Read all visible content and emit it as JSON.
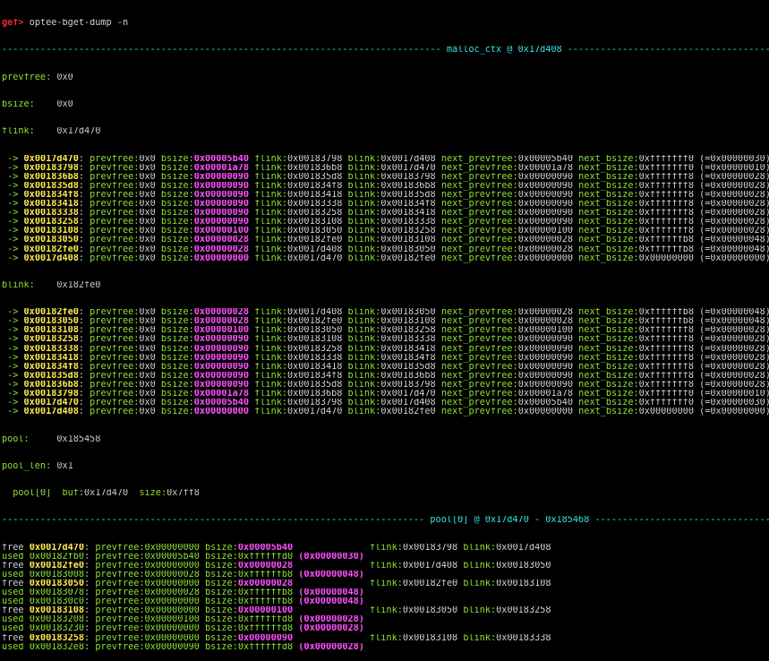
{
  "prompt": "gef>",
  "command": "optee-bget-dump -n",
  "header1": {
    "left": "--------------------------------------------------------------------------------",
    "title": "malloc_ctx @ 0x17d408",
    "right": "--------------------------------------------------------------------"
  },
  "ctx": {
    "prevfree_label": "prevfree:",
    "prevfree": "0x0",
    "bsize_label": "bsize:",
    "bsize": "0x0",
    "flink_label": "flink:",
    "flink": "0x17d470",
    "blink_label": "blink:",
    "blink": "0x182fe0",
    "pool_label": "pool:",
    "pool": "0x185458",
    "pool_len_label": "pool_len:",
    "pool_len": "0x1",
    "pool0": "pool[0]",
    "buf_label": "buf:",
    "buf": "0x17d470",
    "size_label": "size:",
    "size": "0x7ff8"
  },
  "flink_rows": [
    {
      "addr": "0x0017d470",
      "prevfree": "0x0",
      "bsize": "0x00005b40",
      "flink": "0x00183798",
      "blink": "0x0017d408",
      "np": "0x00005b40",
      "nb": "0xfffffff0",
      "eq": "(=0x00000030)"
    },
    {
      "addr": "0x00183798",
      "prevfree": "0x0",
      "bsize": "0x00001a78",
      "flink": "0x001836b8",
      "blink": "0x0017d470",
      "np": "0x00001a78",
      "nb": "0xfffffff0",
      "eq": "(=0x00000010)"
    },
    {
      "addr": "0x001836b8",
      "prevfree": "0x0",
      "bsize": "0x00000090",
      "flink": "0x001835d8",
      "blink": "0x00183798",
      "np": "0x00000090",
      "nb": "0xfffffff8",
      "eq": "(=0x00000028)"
    },
    {
      "addr": "0x001835d8",
      "prevfree": "0x0",
      "bsize": "0x00000090",
      "flink": "0x001834f8",
      "blink": "0x001836b8",
      "np": "0x00000090",
      "nb": "0xfffffff8",
      "eq": "(=0x00000028)"
    },
    {
      "addr": "0x001834f8",
      "prevfree": "0x0",
      "bsize": "0x00000090",
      "flink": "0x00183418",
      "blink": "0x001835d8",
      "np": "0x00000090",
      "nb": "0xfffffff8",
      "eq": "(=0x00000028)"
    },
    {
      "addr": "0x00183418",
      "prevfree": "0x0",
      "bsize": "0x00000090",
      "flink": "0x00183338",
      "blink": "0x001834f8",
      "np": "0x00000090",
      "nb": "0xfffffff8",
      "eq": "(=0x00000028)"
    },
    {
      "addr": "0x00183338",
      "prevfree": "0x0",
      "bsize": "0x00000090",
      "flink": "0x00183258",
      "blink": "0x00183418",
      "np": "0x00000090",
      "nb": "0xfffffff8",
      "eq": "(=0x00000028)"
    },
    {
      "addr": "0x00183258",
      "prevfree": "0x0",
      "bsize": "0x00000090",
      "flink": "0x00183108",
      "blink": "0x00183338",
      "np": "0x00000090",
      "nb": "0xfffffff8",
      "eq": "(=0x00000028)"
    },
    {
      "addr": "0x00183108",
      "prevfree": "0x0",
      "bsize": "0x00000100",
      "flink": "0x00183050",
      "blink": "0x00183258",
      "np": "0x00000100",
      "nb": "0xfffffff8",
      "eq": "(=0x00000028)"
    },
    {
      "addr": "0x00183050",
      "prevfree": "0x0",
      "bsize": "0x00000028",
      "flink": "0x00182fe0",
      "blink": "0x00183108",
      "np": "0x00000028",
      "nb": "0xffffffb8",
      "eq": "(=0x00000048)"
    },
    {
      "addr": "0x00182fe0",
      "prevfree": "0x0",
      "bsize": "0x00000028",
      "flink": "0x0017d408",
      "blink": "0x00183050",
      "np": "0x00000028",
      "nb": "0xffffffb8",
      "eq": "(=0x00000048)"
    },
    {
      "addr": "0x0017d408",
      "prevfree": "0x0",
      "bsize": "0x00000000",
      "flink": "0x0017d470",
      "blink": "0x00182fe0",
      "np": "0x00000000",
      "nb": "0x00000000",
      "eq": "(=0x00000000)"
    }
  ],
  "blink_rows": [
    {
      "addr": "0x00182fe0",
      "prevfree": "0x0",
      "bsize": "0x00000028",
      "flink": "0x0017d408",
      "blink": "0x00183050",
      "np": "0x00000028",
      "nb": "0xffffffb8",
      "eq": "(=0x00000048)"
    },
    {
      "addr": "0x00183050",
      "prevfree": "0x0",
      "bsize": "0x00000028",
      "flink": "0x00182fe0",
      "blink": "0x00183108",
      "np": "0x00000028",
      "nb": "0xffffffb8",
      "eq": "(=0x00000048)"
    },
    {
      "addr": "0x00183108",
      "prevfree": "0x0",
      "bsize": "0x00000100",
      "flink": "0x00183050",
      "blink": "0x00183258",
      "np": "0x00000100",
      "nb": "0xfffffff8",
      "eq": "(=0x00000028)"
    },
    {
      "addr": "0x00183258",
      "prevfree": "0x0",
      "bsize": "0x00000090",
      "flink": "0x00183108",
      "blink": "0x00183338",
      "np": "0x00000090",
      "nb": "0xfffffff8",
      "eq": "(=0x00000028)"
    },
    {
      "addr": "0x00183338",
      "prevfree": "0x0",
      "bsize": "0x00000090",
      "flink": "0x00183258",
      "blink": "0x00183418",
      "np": "0x00000090",
      "nb": "0xfffffff8",
      "eq": "(=0x00000028)"
    },
    {
      "addr": "0x00183418",
      "prevfree": "0x0",
      "bsize": "0x00000090",
      "flink": "0x00183338",
      "blink": "0x001834f8",
      "np": "0x00000090",
      "nb": "0xfffffff8",
      "eq": "(=0x00000028)"
    },
    {
      "addr": "0x001834f8",
      "prevfree": "0x0",
      "bsize": "0x00000090",
      "flink": "0x00183418",
      "blink": "0x001835d8",
      "np": "0x00000090",
      "nb": "0xfffffff8",
      "eq": "(=0x00000028)"
    },
    {
      "addr": "0x001835d8",
      "prevfree": "0x0",
      "bsize": "0x00000090",
      "flink": "0x001834f8",
      "blink": "0x001836b8",
      "np": "0x00000090",
      "nb": "0xfffffff8",
      "eq": "(=0x00000028)"
    },
    {
      "addr": "0x001836b8",
      "prevfree": "0x0",
      "bsize": "0x00000090",
      "flink": "0x001835d8",
      "blink": "0x00183798",
      "np": "0x00000090",
      "nb": "0xfffffff8",
      "eq": "(=0x00000028)"
    },
    {
      "addr": "0x00183798",
      "prevfree": "0x0",
      "bsize": "0x00001a78",
      "flink": "0x001836b8",
      "blink": "0x0017d470",
      "np": "0x00001a78",
      "nb": "0xfffffff0",
      "eq": "(=0x00000010)"
    },
    {
      "addr": "0x0017d470",
      "prevfree": "0x0",
      "bsize": "0x00005b40",
      "flink": "0x00183798",
      "blink": "0x0017d408",
      "np": "0x00005b40",
      "nb": "0xfffffff0",
      "eq": "(=0x00000030)"
    },
    {
      "addr": "0x0017d408",
      "prevfree": "0x0",
      "bsize": "0x00000000",
      "flink": "0x0017d470",
      "blink": "0x00182fe0",
      "np": "0x00000000",
      "nb": "0x00000000",
      "eq": "(=0x00000000)"
    }
  ],
  "header2": {
    "left": "-----------------------------------------------------------------------------",
    "title": "pool[0] @ 0x17d470 - 0x185468",
    "right": "-----------------------------------------------------------------------------------"
  },
  "pool_rows": [
    {
      "state": "free",
      "addr": "0x0017d470",
      "prevfree": "0x00000000",
      "bsize": "0x00005b40",
      "eq": "",
      "flink": "0x00183798",
      "blink": "0x0017d408"
    },
    {
      "state": "used",
      "addr": "0x00182fb0",
      "prevfree": "0x00005b40",
      "bsize": "0xffffffd0",
      "eq": "(0x00000030)",
      "flink": "",
      "blink": ""
    },
    {
      "state": "free",
      "addr": "0x00182fe0",
      "prevfree": "0x00000000",
      "bsize": "0x00000028",
      "eq": "",
      "flink": "0x0017d408",
      "blink": "0x00183050"
    },
    {
      "state": "used",
      "addr": "0x00183008",
      "prevfree": "0x00000028",
      "bsize": "0xffffffb8",
      "eq": "(0x00000048)",
      "flink": "",
      "blink": ""
    },
    {
      "state": "free",
      "addr": "0x00183050",
      "prevfree": "0x00000000",
      "bsize": "0x00000028",
      "eq": "",
      "flink": "0x00182fe0",
      "blink": "0x00183108"
    },
    {
      "state": "used",
      "addr": "0x00183078",
      "prevfree": "0x00000028",
      "bsize": "0xffffffb8",
      "eq": "(0x00000048)",
      "flink": "",
      "blink": ""
    },
    {
      "state": "used",
      "addr": "0x001830c0",
      "prevfree": "0x00000000",
      "bsize": "0xffffffb8",
      "eq": "(0x00000048)",
      "flink": "",
      "blink": ""
    },
    {
      "state": "free",
      "addr": "0x00183108",
      "prevfree": "0x00000000",
      "bsize": "0x00000100",
      "eq": "",
      "flink": "0x00183050",
      "blink": "0x00183258"
    },
    {
      "state": "used",
      "addr": "0x00183208",
      "prevfree": "0x00000100",
      "bsize": "0xffffffd8",
      "eq": "(0x00000028)",
      "flink": "",
      "blink": ""
    },
    {
      "state": "used",
      "addr": "0x00183230",
      "prevfree": "0x00000000",
      "bsize": "0xffffffd8",
      "eq": "(0x00000028)",
      "flink": "",
      "blink": ""
    },
    {
      "state": "free",
      "addr": "0x00183258",
      "prevfree": "0x00000000",
      "bsize": "0x00000090",
      "eq": "",
      "flink": "0x00183108",
      "blink": "0x00183338"
    },
    {
      "state": "used",
      "addr": "0x001832e8",
      "prevfree": "0x00000090",
      "bsize": "0xffffffd8",
      "eq": "(0x00000028)",
      "flink": "",
      "blink": ""
    }
  ],
  "colors": {
    "background": "#000000",
    "address": "#fce94f",
    "size": "#ff50ff",
    "label": "#8ae234",
    "separator": "#34e2e2"
  }
}
